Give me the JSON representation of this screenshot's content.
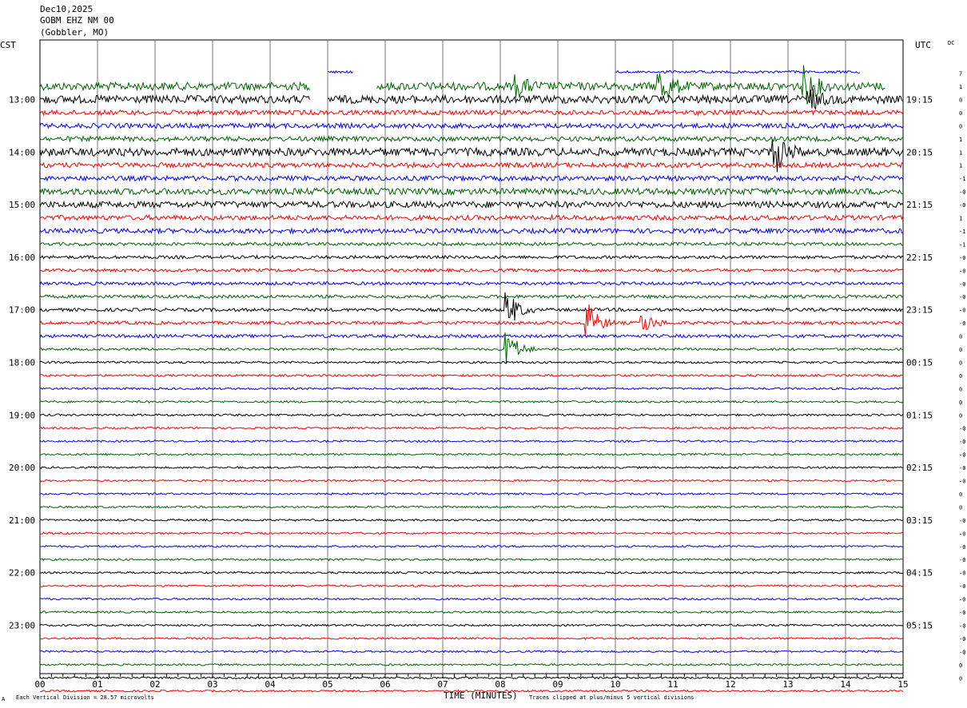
{
  "header": {
    "date": "Dec10,2025",
    "station": "GOBM EHZ NM 00",
    "location": "(Gobbler, MO)"
  },
  "labels": {
    "left_tz": "CST",
    "right_tz": "UTC",
    "dc": "DC",
    "xlabel": "TIME (MINUTES)",
    "scale_note": "Each Vertical Division =   28.57 microvolts",
    "clip_note": "Traces clipped at plus/minus 5 vertical divisions",
    "corner_mark": "A"
  },
  "colors": [
    "#000000",
    "#ff0000",
    "#0000ff",
    "#006400"
  ],
  "chart_data": {
    "type": "line",
    "title": "GOBM EHZ NM 00",
    "xlabel": "TIME (MINUTES)",
    "xlim": [
      0,
      15
    ],
    "x_ticks": [
      "00",
      "01",
      "02",
      "03",
      "04",
      "05",
      "06",
      "07",
      "08",
      "09",
      "10",
      "11",
      "12",
      "13",
      "14",
      "15"
    ],
    "left_hour_labels": [
      "13:00",
      "14:00",
      "15:00",
      "16:00",
      "17:00",
      "18:00",
      "19:00",
      "20:00",
      "21:00",
      "22:00",
      "23:00"
    ],
    "right_hour_labels": [
      "19:15",
      "20:15",
      "21:15",
      "22:15",
      "23:15",
      "00:15",
      "01:15",
      "02:15",
      "03:15",
      "04:15",
      "05:15"
    ],
    "dc_offsets": [
      "7",
      "1",
      "0",
      "0",
      "0",
      "1",
      "1",
      "1",
      "-1",
      "-0",
      "-0",
      "1",
      "-1",
      "-1",
      "-0",
      "-0",
      "-0",
      "-0",
      "-0",
      "-0",
      "0",
      "0",
      "0",
      "0",
      "0",
      "0",
      "0",
      "-0",
      "-0",
      "-0",
      "-0",
      "-0",
      "0",
      "0",
      "-0",
      "-0",
      "-0",
      "-0",
      "-0",
      "-0",
      "-0",
      "-0",
      "-0",
      "-0",
      "-0",
      "0",
      "0"
    ],
    "trace_start_hour": "12:45",
    "trace_minutes": 15,
    "trace_count": 47,
    "trace_color_cycle": [
      "green",
      "black",
      "red",
      "blue"
    ],
    "gaps": [
      {
        "trace": 0,
        "from_min": 4.7,
        "to_min": 5.85
      },
      {
        "trace": 0,
        "from_min": 14.7,
        "to_min": 15
      },
      {
        "trace": 1,
        "from_min": 4.7,
        "to_min": 5.0
      }
    ],
    "partial_blue_segments": [
      {
        "from_min": 5.0,
        "to_min": 5.45
      },
      {
        "from_min": 10.0,
        "to_min": 14.25
      }
    ],
    "events": [
      {
        "trace": 0,
        "minute": 8.3,
        "amplitude": "medium"
      },
      {
        "trace": 0,
        "minute": 10.8,
        "amplitude": "large"
      },
      {
        "trace": 0,
        "minute": 13.3,
        "amplitude": "large"
      },
      {
        "trace": 1,
        "minute": 13.4,
        "amplitude": "medium"
      },
      {
        "trace": 5,
        "minute": 12.8,
        "amplitude": "large"
      },
      {
        "trace": 17,
        "minute": 8.15,
        "amplitude": "large"
      },
      {
        "trace": 18,
        "minute": 9.55,
        "amplitude": "large"
      },
      {
        "trace": 18,
        "minute": 10.5,
        "amplitude": "medium"
      },
      {
        "trace": 20,
        "minute": 8.15,
        "amplitude": "large"
      }
    ],
    "noise_level_by_trace": [
      5,
      5,
      3,
      3,
      3,
      5,
      3,
      3,
      4,
      4,
      3,
      3,
      2,
      2,
      2,
      2,
      2,
      2,
      2,
      2,
      1.5,
      1.3,
      1.3,
      1.3,
      1.3,
      1.3,
      1.2,
      1.2,
      1.2,
      1.2,
      1.2,
      1.2,
      1.2,
      1.2,
      1.2,
      1.2,
      1.2,
      1.2,
      1.2,
      1.2,
      1.2,
      1.2,
      1.2,
      1.2,
      1.2,
      1.2,
      1.2
    ]
  }
}
